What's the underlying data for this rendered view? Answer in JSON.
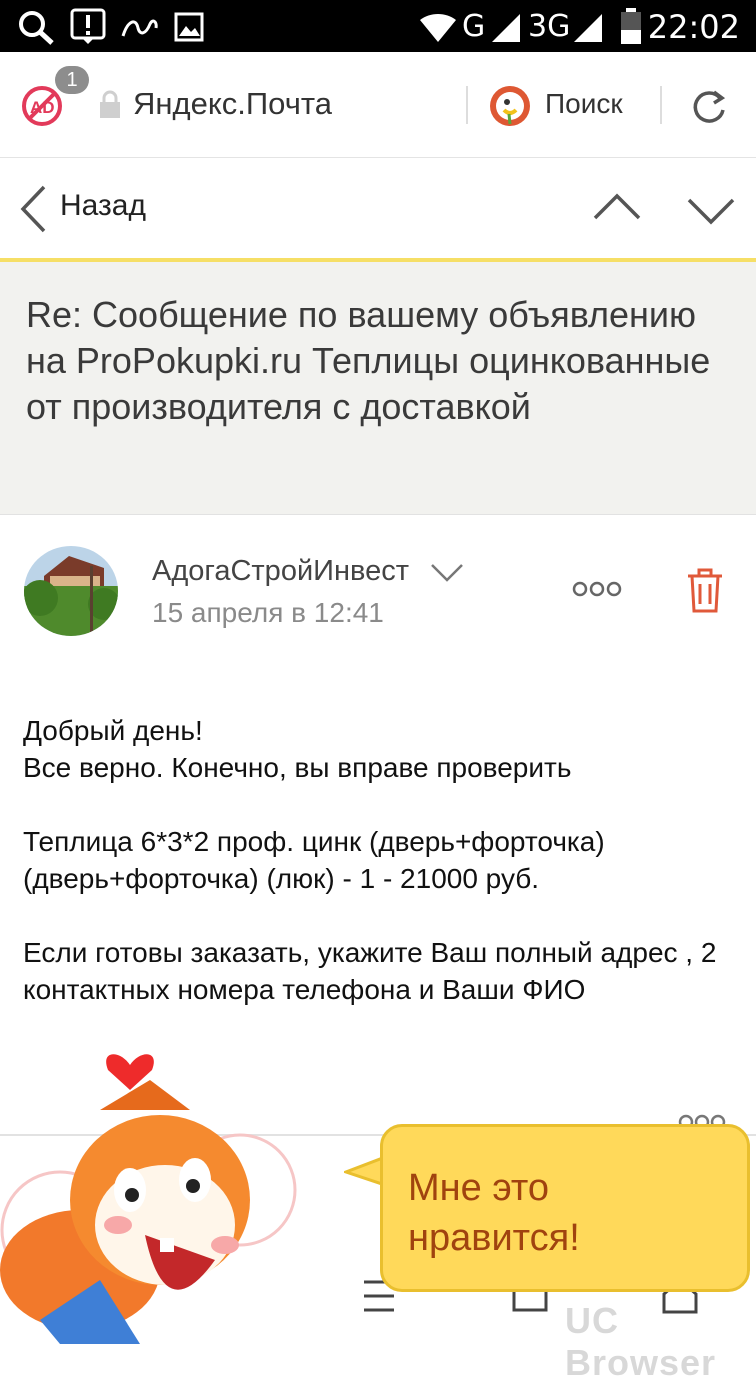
{
  "status_bar": {
    "time": "22:02",
    "network_g": "G",
    "network_3g": "3G",
    "icons": [
      "search-icon",
      "alert-icon",
      "app-icon",
      "image-icon",
      "wifi-icon",
      "signal-icon",
      "battery-icon"
    ]
  },
  "browser": {
    "adblock_count": "1",
    "page_title": "Яндекс.Почта",
    "search_label": "Поиск"
  },
  "nav": {
    "back_label": "Назад"
  },
  "subject": "Re: Сообщение по вашему объявлению на ProPokupki.ru Теплицы оцинкованные от производителя с доставкой",
  "message": {
    "sender": "АдогаСтройИнвест",
    "date": "15 апреля в 12:41",
    "body": "Добрый день!\nВсе верно. Конечно, вы вправе проверить\n\nТеплица 6*3*2 проф. цинк (дверь+форточка) (дверь+форточка) (люк) - 1 - 21000 руб.\n\nЕсли готовы заказать, укажите Ваш полный адрес , 2 контактных номера телефона и Ваши ФИО"
  },
  "promo": {
    "bubble_text": "Мне это\nнравится!",
    "watermark": "UC Browser"
  },
  "colors": {
    "accent_yellow": "#f6df66",
    "trash_red": "#e0593a",
    "bubble": "#ffd95a"
  }
}
